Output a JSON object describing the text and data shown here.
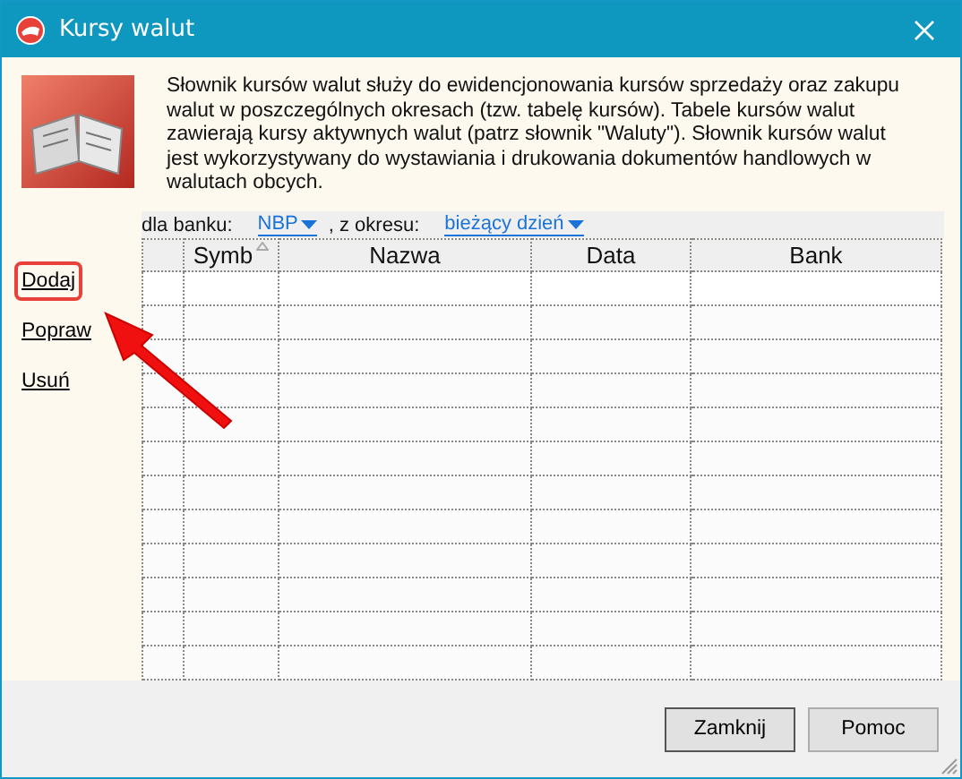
{
  "window": {
    "title": "Kursy walut"
  },
  "description": "Słownik kursów walut służy do ewidencjonowania kursów sprzedaży oraz zakupu walut w poszczególnych okresach (tzw. tabelę kursów). Tabele kursów walut zawierają kursy aktywnych walut (patrz słownik \"Waluty\"). Słownik kursów walut jest wykorzystywany do wystawiania i drukowania dokumentów handlowych w walutach obcych.",
  "actions": [
    {
      "label": "Dodaj",
      "highlighted": true
    },
    {
      "label": "Popraw",
      "highlighted": false
    },
    {
      "label": "Usuń",
      "highlighted": false
    }
  ],
  "filter": {
    "bank_label": "dla banku:",
    "bank": "NBP",
    "period_label": ", z okresu:",
    "period": "bieżący dzień"
  },
  "table": {
    "columns": [
      {
        "label": "Symb",
        "sorted": true
      },
      {
        "label": "Nazwa",
        "sorted": false
      },
      {
        "label": "Data",
        "sorted": false
      },
      {
        "label": "Bank",
        "sorted": false
      }
    ]
  },
  "buttons": [
    "Zamknij",
    "Pomoc"
  ]
}
